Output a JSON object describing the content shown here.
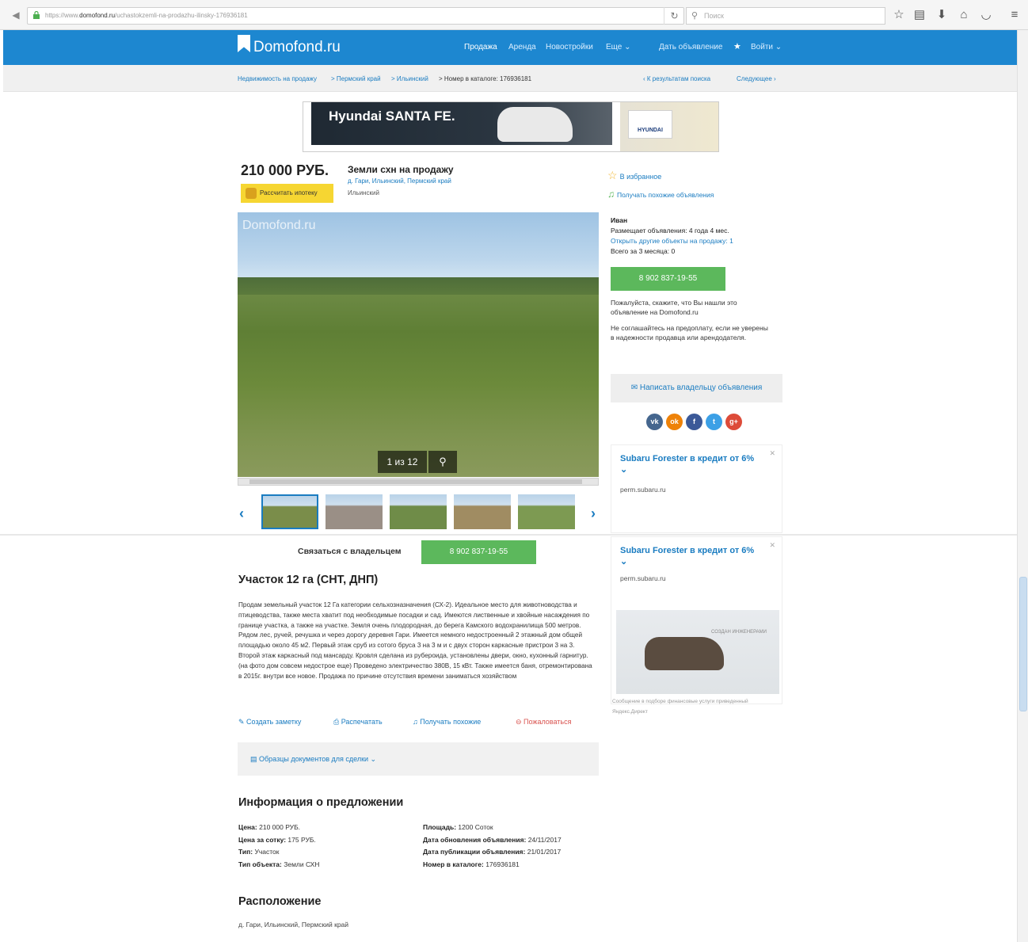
{
  "browser": {
    "url_prefix": "https://www.",
    "url_domain": "domofond.ru",
    "url_path": "/uchastokzemli-na-prodazhu-ilinsky-176936181",
    "search_placeholder": "Поиск"
  },
  "header": {
    "logo": "Domofond.ru",
    "nav": [
      "Продажа",
      "Аренда",
      "Новостройки",
      "Еще ⌄"
    ],
    "post_ad": "Дать объявление",
    "login": "Войти ⌄"
  },
  "breadcrumb": {
    "items": [
      "Недвижимость на продажу",
      "> Пермский край",
      "> Ильинский",
      "> Номер в каталоге: 176936181"
    ],
    "back": "‹ К результатам поиска",
    "next": "Следующее ›"
  },
  "banner": {
    "title": "Hyundai SANTA FE.",
    "brand": "HYUNDAI"
  },
  "listing": {
    "price": "210 000 РУБ.",
    "mortgage_button": "Рассчитать ипотеку",
    "title": "Земли схн на продажу",
    "address": "д. Гари, Ильинский, Пермский край",
    "district": "Ильинский"
  },
  "gallery": {
    "watermark": "Domofond.ru",
    "counter": "1 из 12",
    "thumb_colors": [
      "#7a8d4a",
      "#9a8f86",
      "#6f8c48",
      "#a08c62",
      "#7d9a52"
    ]
  },
  "sidebar": {
    "favorite": "В избранное",
    "similar": "Получать похожие объявления",
    "seller_name": "Иван",
    "seller_since": "Размещает объявления: 4 года 4 мес.",
    "seller_other": "Открыть другие объекты на продажу: 1",
    "seller_total": "Всего за 3 месяца: 0",
    "phone": "8 902 837-19-55",
    "note1": "Пожалуйста, скажите, что Вы нашли это объявление на Domofond.ru",
    "note2": "Не соглашайтесь на предоплату, если не уверены в надежности продавца или арендодателя.",
    "message_button": "Написать владельцу объявления",
    "socials": [
      "vk",
      "ok",
      "f",
      "t",
      "g+"
    ]
  },
  "side_ads": [
    {
      "title": "Subaru Forester в кредит от 6% ⌄",
      "url": "perm.subaru.ru"
    },
    {
      "title": "Subaru Forester в кредит от 6% ⌄",
      "url": "perm.subaru.ru",
      "caption": "СОЗДАН ИНЖЕНЕРАМИ"
    }
  ],
  "ad_footer": {
    "line1": "Сообщение в подборе финансовые услуги приведенный",
    "line2": "Яндекс.Директ"
  },
  "contact": {
    "label": "Связаться с владельцем",
    "phone": "8 902 837-19-55"
  },
  "description": {
    "heading": "Участок 12 га (СНТ, ДНП)",
    "text": "Продам земельный участок 12 Га категории сельхозназначения (СХ-2). Идеальное место для животноводства и птицеводства, также места хватит под необходимые посадки и сад. Имеются лиственные и хвойные насаждения по границе участка, а также на участке. Земля очень плодородная, до берега Камского водохранилища 500 метров. Рядом лес, ручей, речушка и через дорогу деревня Гари. Имеется немного недостроенный 2 этажный дом общей площадью около 45 м2. Первый этаж сруб из сотого бруса 3 на 3 м и с двух сторон каркасные пристрои 3 на 3. Второй этаж каркасный под мансарду. Кровля сделана из рубероида, установлены двери, окно, кухонный гарнитур. (на фото дом совсем недострое еще) Проведено электричество 380В, 15 кВт. Также имеется баня, отремонтирована в 2015г. внутри все новое. Продажа по причине отсутствия времени заниматься хозяйством"
  },
  "actions": [
    "Создать заметку",
    "Распечатать",
    "Получать похожие",
    "Пожаловаться"
  ],
  "docs": "Образцы документов для сделки ⌄",
  "info": {
    "heading": "Информация о предложении",
    "left": [
      {
        "k": "Цена:",
        "v": "210 000 РУБ."
      },
      {
        "k": "Цена за сотку:",
        "v": "175 РУБ."
      },
      {
        "k": "Тип:",
        "v": "Участок"
      },
      {
        "k": "Тип объекта:",
        "v": "Земли СХН"
      }
    ],
    "right": [
      {
        "k": "Площадь:",
        "v": "1200 Соток"
      },
      {
        "k": "Дата обновления объявления:",
        "v": "24/11/2017"
      },
      {
        "k": "Дата публикации объявления:",
        "v": "21/01/2017"
      },
      {
        "k": "Номер в каталоге:",
        "v": "176936181"
      }
    ]
  },
  "location": {
    "heading": "Расположение",
    "address": "д. Гари, Ильинский, Пермский край"
  }
}
